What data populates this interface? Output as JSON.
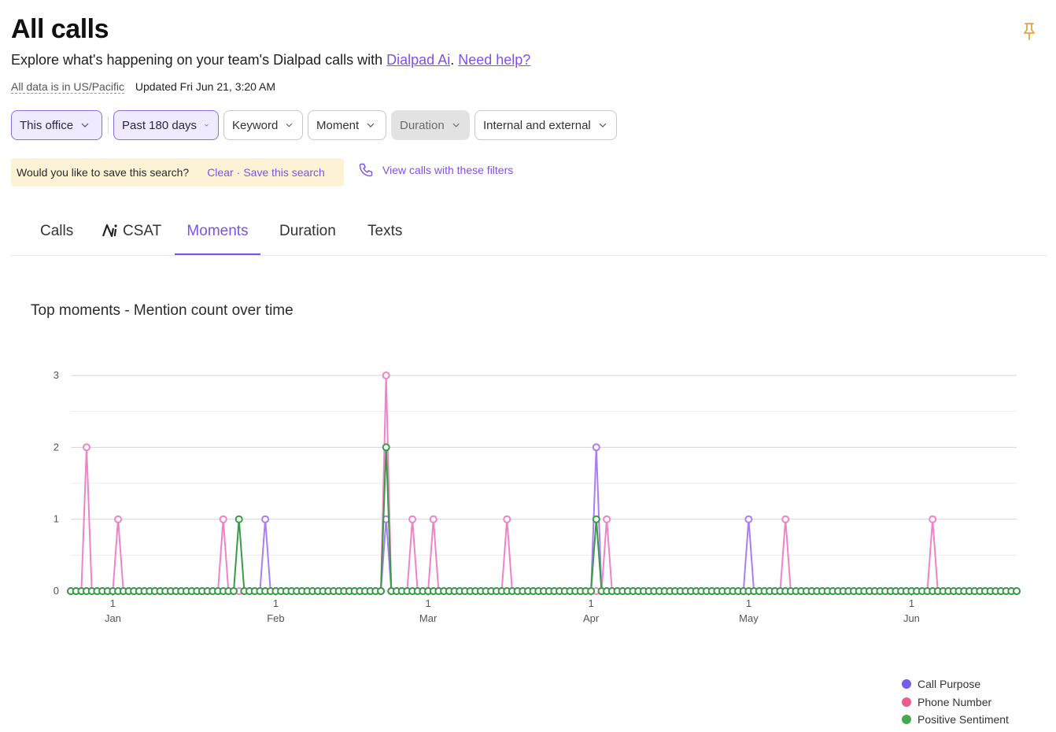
{
  "header": {
    "title": "All calls",
    "subtitle_prefix": "Explore what's happening on your team's Dialpad calls with ",
    "dialpad_ai_link": "Dialpad Ai",
    "subtitle_mid": ". ",
    "help_link": "Need help?",
    "timezone_note": "All data is in US/Pacific",
    "updated": "Updated Fri Jun 21, 3:20 AM",
    "pin_icon": "pin-icon"
  },
  "filters": [
    {
      "label": "This office",
      "state": "active"
    },
    {
      "label": "Past 180 days",
      "state": "active"
    },
    {
      "label": "Keyword",
      "state": "normal"
    },
    {
      "label": "Moment",
      "state": "normal"
    },
    {
      "label": "Duration",
      "state": "disabled"
    },
    {
      "label": "Internal and external",
      "state": "normal"
    }
  ],
  "save_search": {
    "prompt": "Would you like to save this search?",
    "clear_label": "Clear",
    "separator": "·",
    "save_label": "Save this search"
  },
  "view_calls": {
    "label": "View calls with these filters",
    "icon": "phone-icon"
  },
  "tabs": [
    {
      "label": "Calls",
      "selected": false
    },
    {
      "label": "CSAT",
      "ai_prefix": "Ai",
      "selected": false
    },
    {
      "label": "Moments",
      "selected": true
    },
    {
      "label": "Duration",
      "selected": false
    },
    {
      "label": "Texts",
      "selected": false
    }
  ],
  "chart_title": "Top moments - Mention count over time",
  "colors": {
    "accent": "#7c52e8",
    "call_purpose": "#a97ff0",
    "phone_number": "#ee83c9",
    "positive_sentiment": "#3a9a47",
    "legend_call_purpose": "#7a5ae8",
    "legend_phone_number": "#ee5a8e",
    "legend_positive_sentiment": "#47a84f"
  },
  "chart_data": {
    "type": "line",
    "title": "Top moments - Mention count over time",
    "xlabel": "",
    "ylabel": "",
    "ylim": [
      0,
      3
    ],
    "y_ticks": [
      0,
      1,
      2,
      3
    ],
    "x_ticks": [
      {
        "date": "2024-01-01",
        "day": "1",
        "month": "Jan"
      },
      {
        "date": "2024-02-01",
        "day": "1",
        "month": "Feb"
      },
      {
        "date": "2024-03-01",
        "day": "1",
        "month": "Mar"
      },
      {
        "date": "2024-04-01",
        "day": "1",
        "month": "Apr"
      },
      {
        "date": "2024-05-01",
        "day": "1",
        "month": "May"
      },
      {
        "date": "2024-06-01",
        "day": "1",
        "month": "Jun"
      }
    ],
    "x_range": [
      "2023-12-24",
      "2024-06-21"
    ],
    "grid": true,
    "legend_position": "bottom-right",
    "series": [
      {
        "name": "Call Purpose",
        "color_key": "call_purpose",
        "nonzero": [
          {
            "date": "2024-01-30",
            "value": 1
          },
          {
            "date": "2024-02-22",
            "value": 1
          },
          {
            "date": "2024-04-02",
            "value": 2
          },
          {
            "date": "2024-05-01",
            "value": 1
          }
        ]
      },
      {
        "name": "Phone Number",
        "color_key": "phone_number",
        "nonzero": [
          {
            "date": "2023-12-27",
            "value": 2
          },
          {
            "date": "2024-01-02",
            "value": 1
          },
          {
            "date": "2024-01-22",
            "value": 1
          },
          {
            "date": "2024-02-22",
            "value": 3
          },
          {
            "date": "2024-02-27",
            "value": 1
          },
          {
            "date": "2024-03-02",
            "value": 1
          },
          {
            "date": "2024-03-16",
            "value": 1
          },
          {
            "date": "2024-04-04",
            "value": 1
          },
          {
            "date": "2024-05-08",
            "value": 1
          },
          {
            "date": "2024-06-05",
            "value": 1
          }
        ]
      },
      {
        "name": "Positive Sentiment",
        "color_key": "positive_sentiment",
        "nonzero": [
          {
            "date": "2024-01-25",
            "value": 1
          },
          {
            "date": "2024-02-22",
            "value": 2
          },
          {
            "date": "2024-04-02",
            "value": 1
          }
        ]
      }
    ]
  },
  "legend": [
    {
      "label": "Call Purpose",
      "color_key": "legend_call_purpose"
    },
    {
      "label": "Phone Number",
      "color_key": "legend_phone_number"
    },
    {
      "label": "Positive Sentiment",
      "color_key": "legend_positive_sentiment"
    }
  ]
}
